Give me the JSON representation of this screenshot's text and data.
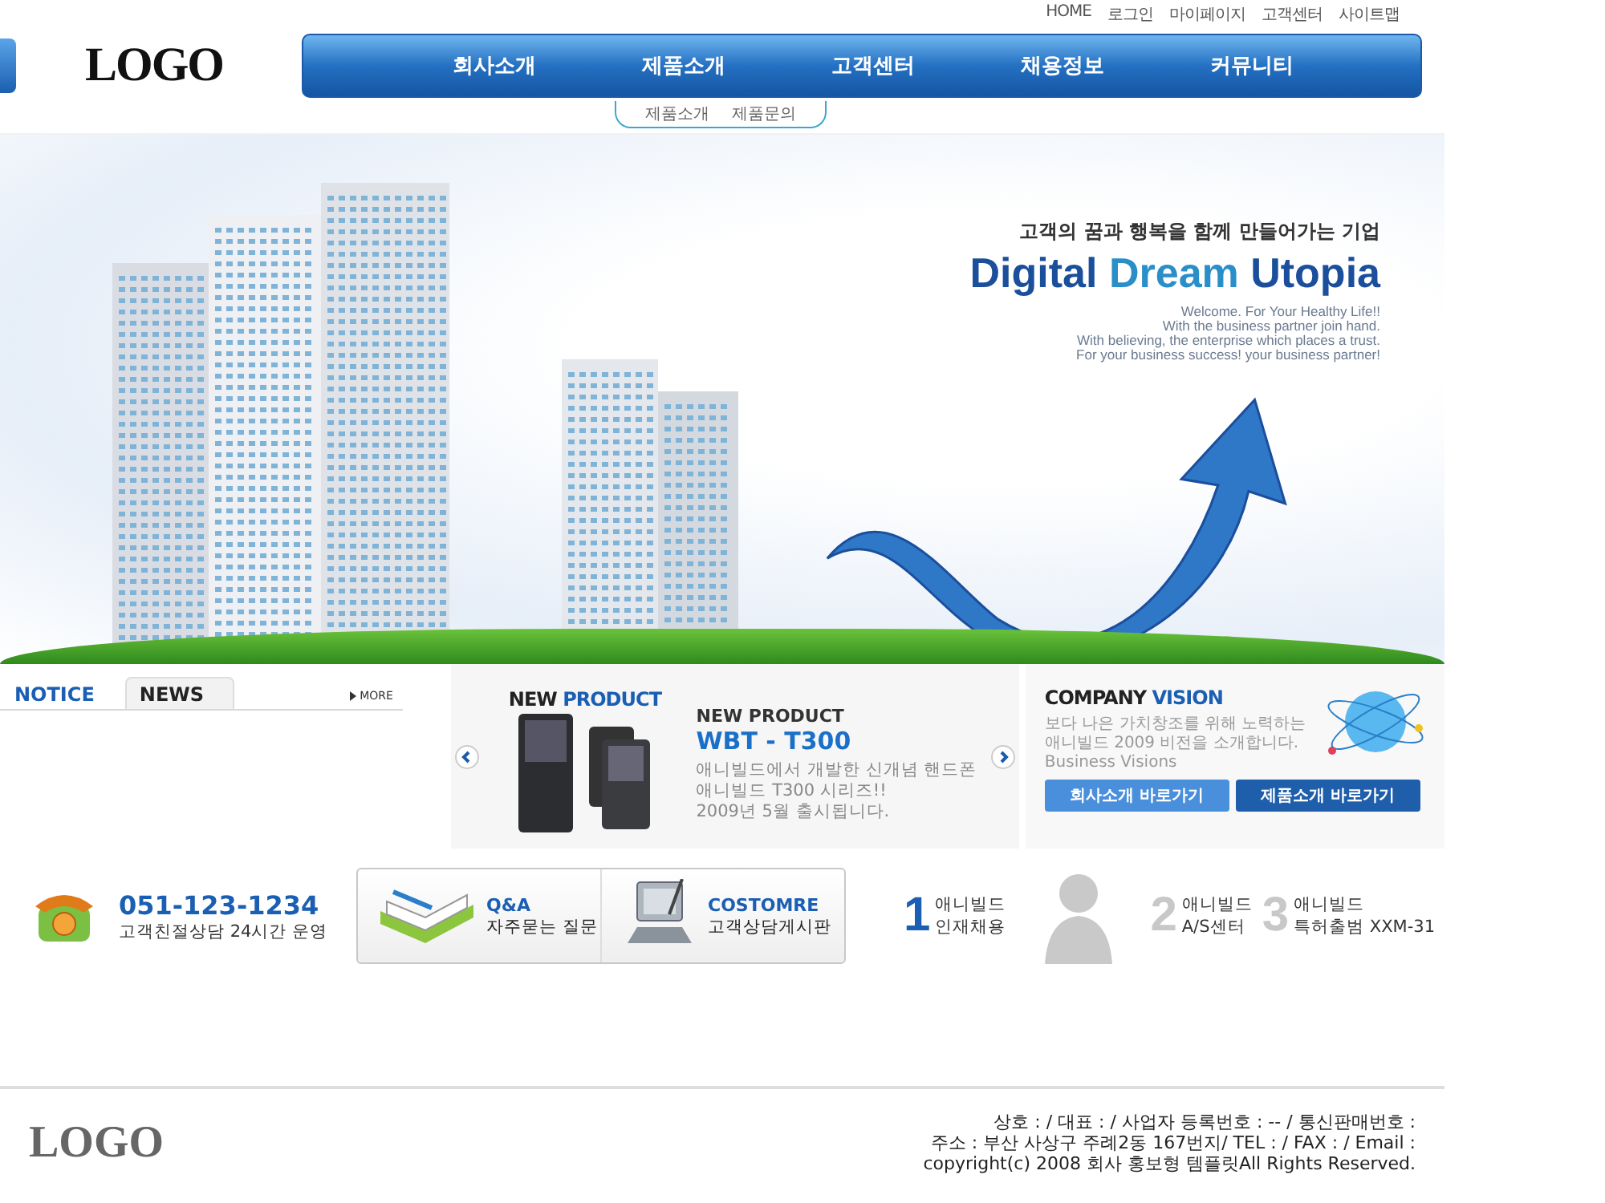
{
  "top_links": [
    "HOME",
    "로그인",
    "마이페이지",
    "고객센터",
    "사이트맵"
  ],
  "logo": "LOGO",
  "nav": [
    "회사소개",
    "제품소개",
    "고객센터",
    "채용정보",
    "커뮤니티"
  ],
  "subnav": [
    "제품소개",
    "제품문의"
  ],
  "hero": {
    "tagline": "고객의 꿈과 행복을 함께 만들어가는 기업",
    "title": [
      {
        "text": "Digital",
        "color": "#1b4f9c"
      },
      {
        "text": "Dream",
        "color": "#2a8ec8"
      },
      {
        "text": "Utopia",
        "color": "#1b4f9c"
      }
    ],
    "welcome": [
      "Welcome. For Your Healthy Life!!",
      "With the business partner join hand.",
      "With believing, the enterprise which places a trust.",
      "For your business success! your business partner!"
    ]
  },
  "board": {
    "tabs": [
      {
        "label": "NOTICE",
        "selected": true
      },
      {
        "label": "NEWS",
        "selected": false
      }
    ],
    "more": "MORE"
  },
  "product": {
    "heading_1": "NEW",
    "heading_2": "PRODUCT",
    "label": "NEW PRODUCT",
    "model": "WBT - T300",
    "description": [
      "애니빌드에서 개발한 신개념 핸드폰",
      "애니빌드 T300 시리즈!!",
      "2009년 5월 출시됩니다."
    ]
  },
  "vision": {
    "heading_1": "COMPANY",
    "heading_2": "VISION",
    "text": [
      "보다 나은 가치창조를 위해 노력하는",
      "애니빌드 2009 비전을 소개합니다.",
      "Business Visions"
    ],
    "buttons": [
      {
        "label": "회사소개 바로가기",
        "color": "#4a8fdc"
      },
      {
        "label": "제품소개 바로가기",
        "color": "#1f5eaa"
      }
    ]
  },
  "contact": {
    "phone": "051-123-1234",
    "hours": "고객친절상담 24시간 운영"
  },
  "boards": [
    {
      "title": "Q&A",
      "subtitle": "자주묻는 질문"
    },
    {
      "title": "COSTOMRE",
      "subtitle": "고객상담게시판"
    }
  ],
  "links": [
    {
      "number": "1",
      "line_1": "애니빌드",
      "line_2": "인재채용",
      "color": "#1a5fb4"
    },
    {
      "number": "2",
      "line_1": "애니빌드",
      "line_2": "A/S센터",
      "color": "#c8c8c8"
    },
    {
      "number": "3",
      "line_1": "애니빌드",
      "line_2": "특허출범 XXM-31",
      "color": "#c8c8c8"
    }
  ],
  "footer": {
    "logo": "LOGO",
    "lines": [
      "상호 : / 대표 : / 사업자 등록번호 : -- / 통신판매번호 :",
      "주소 : 부산 사상구 주례2동 167번지/ TEL : / FAX : / Email :",
      "copyright(c) 2008 회사 홍보형 템플릿All Rights Reserved."
    ]
  }
}
